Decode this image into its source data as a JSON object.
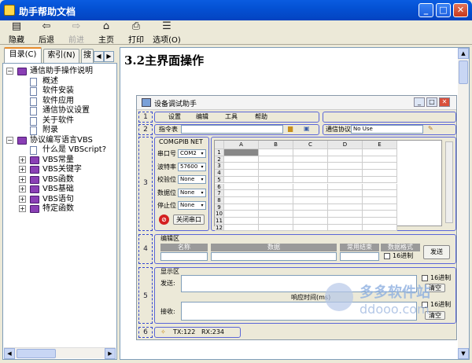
{
  "window": {
    "title": "助手帮助文档",
    "min": "_",
    "max": "□",
    "close": "✕"
  },
  "toolbar": {
    "hide": "隐藏",
    "back": "后退",
    "forward": "前进",
    "home": "主页",
    "print": "打印",
    "options": "选项(O)"
  },
  "tabs": {
    "contents": "目录(C)",
    "index": "索引(N)",
    "search": "搜"
  },
  "tree": [
    {
      "label": "通信助手操作说明",
      "type": "book",
      "expand": "−",
      "level": 0
    },
    {
      "label": "概述",
      "type": "doc",
      "level": 1
    },
    {
      "label": "软件安装",
      "type": "doc",
      "level": 1
    },
    {
      "label": "软件应用",
      "type": "doc",
      "level": 1,
      "selected": true
    },
    {
      "label": "通信协议设置",
      "type": "doc",
      "level": 1
    },
    {
      "label": "关于软件",
      "type": "doc",
      "level": 1
    },
    {
      "label": "附录",
      "type": "doc",
      "level": 1
    },
    {
      "label": "协议编写语言VBS",
      "type": "book",
      "expand": "−",
      "level": 0
    },
    {
      "label": "什么是 VBScript?",
      "type": "doc",
      "level": 1
    },
    {
      "label": "VBS常量",
      "type": "book",
      "expand": "+",
      "level": 1
    },
    {
      "label": "VBS关键字",
      "type": "book",
      "expand": "+",
      "level": 1
    },
    {
      "label": "VBS函数",
      "type": "book",
      "expand": "+",
      "level": 1
    },
    {
      "label": "VBS基础",
      "type": "book",
      "expand": "+",
      "level": 1
    },
    {
      "label": "VBS语句",
      "type": "book",
      "expand": "+",
      "level": 1
    },
    {
      "label": "特定函数",
      "type": "book",
      "expand": "+",
      "level": 1
    }
  ],
  "page": {
    "heading": "3.2主界面操作"
  },
  "inner": {
    "title": "设备调试助手",
    "menu": [
      "设置",
      "编辑",
      "工具",
      "帮助"
    ],
    "cmd_label": "指令表",
    "proto_label": "通信协议",
    "proto_value": "No Use",
    "subtabs": [
      "COM",
      "GPIB",
      "NET"
    ],
    "fields": [
      {
        "label": "串口号",
        "value": "COM2"
      },
      {
        "label": "波特率",
        "value": "57600"
      },
      {
        "label": "校验位",
        "value": "None"
      },
      {
        "label": "数据位",
        "value": "None"
      },
      {
        "label": "停止位",
        "value": "None"
      }
    ],
    "close_port": "关闭串口",
    "grid_cols": [
      "A",
      "B",
      "C",
      "D",
      "E"
    ],
    "grid_rows": [
      "1",
      "2",
      "3",
      "4",
      "5",
      "6",
      "7",
      "8",
      "9",
      "10",
      "11",
      "12"
    ],
    "edit_area": "编辑区",
    "edit_headers": [
      "名称",
      "数据",
      "常用结束",
      "数据格式"
    ],
    "hex": "16进制",
    "send": "发送",
    "display_area": "显示区",
    "send_lbl": "发送:",
    "recv_lbl": "接收:",
    "resp_time": "响应时间(ms)",
    "clear": "清空",
    "tx": "TX:122",
    "rx": "RX:234",
    "nums": [
      "1",
      "2",
      "3",
      "4",
      "5",
      "6",
      "7",
      "8"
    ]
  },
  "watermark": {
    "cn": "多多软件站",
    "en": "ddooo.com"
  }
}
